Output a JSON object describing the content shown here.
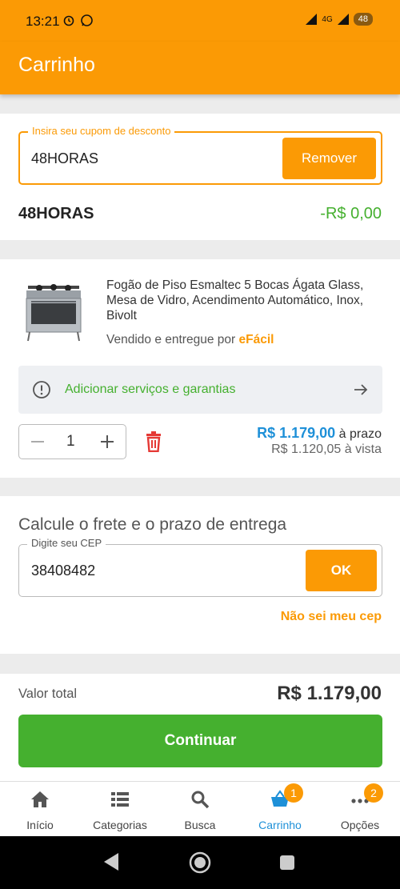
{
  "status_bar": {
    "time": "13:21",
    "network": "4G",
    "battery": "48"
  },
  "header": {
    "title": "Carrinho"
  },
  "coupon": {
    "label": "Insira seu cupom de desconto",
    "value": "48HORAS",
    "remove_label": "Remover",
    "applied_code": "48HORAS",
    "discount": "-R$ 0,00"
  },
  "product": {
    "name": "Fogão de Piso Esmaltec 5 Bocas Ágata Glass, Mesa de Vidro, Acendimento Automático, Inox, Bivolt",
    "seller_prefix": "Vendido e entregue por",
    "seller": "eFácil",
    "services_label": "Adicionar serviços e garantias",
    "quantity": "1",
    "price_installment": "R$ 1.179,00",
    "installment_suffix": "à prazo",
    "price_cash": "R$ 1.120,05 à vista"
  },
  "shipping": {
    "title": "Calcule o frete e o prazo de entrega",
    "cep_label": "Digite seu CEP",
    "cep_value": "38408482",
    "ok_label": "OK",
    "no_cep_link": "Não sei meu cep"
  },
  "summary": {
    "total_label": "Valor total",
    "total_value": "R$ 1.179,00",
    "continue_label": "Continuar"
  },
  "bottom_nav": {
    "items": [
      {
        "label": "Início",
        "icon": "home-icon"
      },
      {
        "label": "Categorias",
        "icon": "list-icon"
      },
      {
        "label": "Busca",
        "icon": "search-icon"
      },
      {
        "label": "Carrinho",
        "icon": "cart-icon",
        "badge": "1",
        "active": true
      },
      {
        "label": "Opções",
        "icon": "more-icon",
        "badge": "2"
      }
    ]
  },
  "colors": {
    "brand": "#fb9a05",
    "success": "#45b02f",
    "price": "#1e90d8",
    "danger": "#e53935"
  }
}
